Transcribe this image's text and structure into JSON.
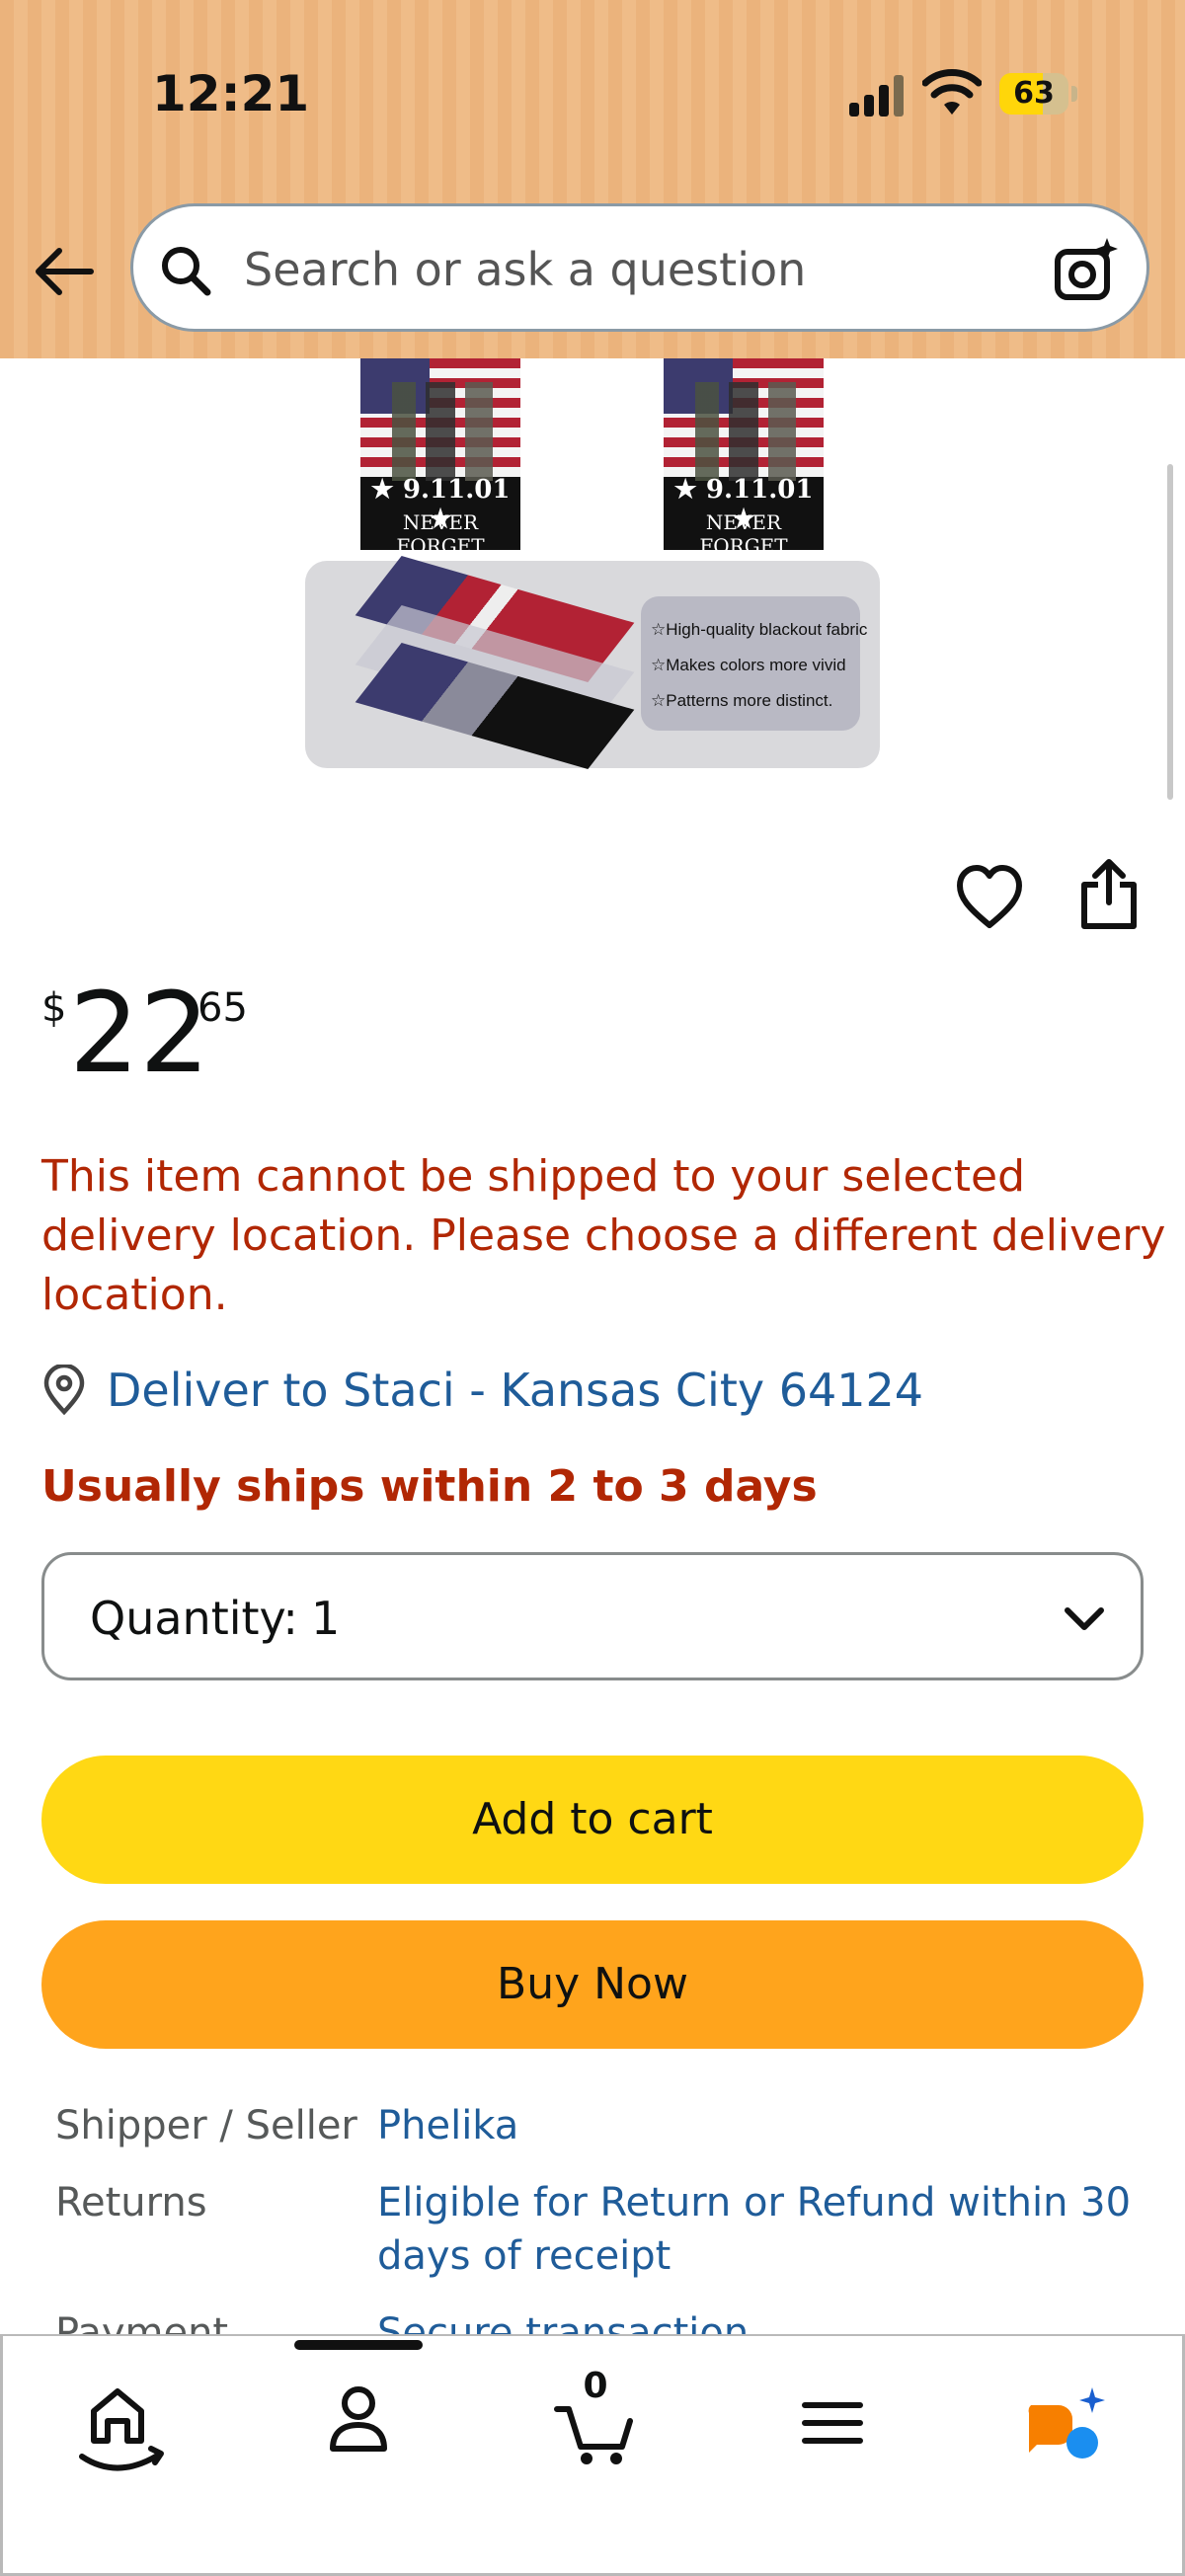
{
  "status_bar": {
    "time": "12:21",
    "battery": "63",
    "battery_level": 0.63
  },
  "search": {
    "placeholder": "Search or ask a question"
  },
  "gallery": {
    "poster_line1": "★ 9.11.01 ★",
    "poster_line2": "NEVER FORGET",
    "features": [
      "☆High-quality blackout fabric",
      "☆Makes colors more vivid",
      "☆Patterns more distinct."
    ],
    "page_count": 5,
    "active_index": 2
  },
  "price": {
    "currency": "$",
    "whole": "22",
    "fraction": "65"
  },
  "shipping_error": "This item cannot be shipped to your selected delivery location. Please choose a different delivery location.",
  "deliver_to": "Deliver to Staci - Kansas City 64124",
  "ships_message": "Usually ships within 2 to 3 days",
  "quantity": {
    "label": "Quantity:",
    "value": "1"
  },
  "buttons": {
    "add_to_cart": "Add to cart",
    "buy_now": "Buy Now"
  },
  "info_rows": [
    {
      "key": "Shipper / Seller",
      "value": "Phelika"
    },
    {
      "key": "Returns",
      "value": "Eligible for Return or Refund within 30 days of receipt"
    },
    {
      "key": "Payment",
      "value": "Secure transaction"
    }
  ],
  "nav": {
    "cart_count": "0"
  },
  "colors": {
    "header": "#ebb37c",
    "add_to_cart": "#ffd814",
    "buy_now": "#ffa41c",
    "error": "#b12704",
    "link": "#1f5c99"
  }
}
